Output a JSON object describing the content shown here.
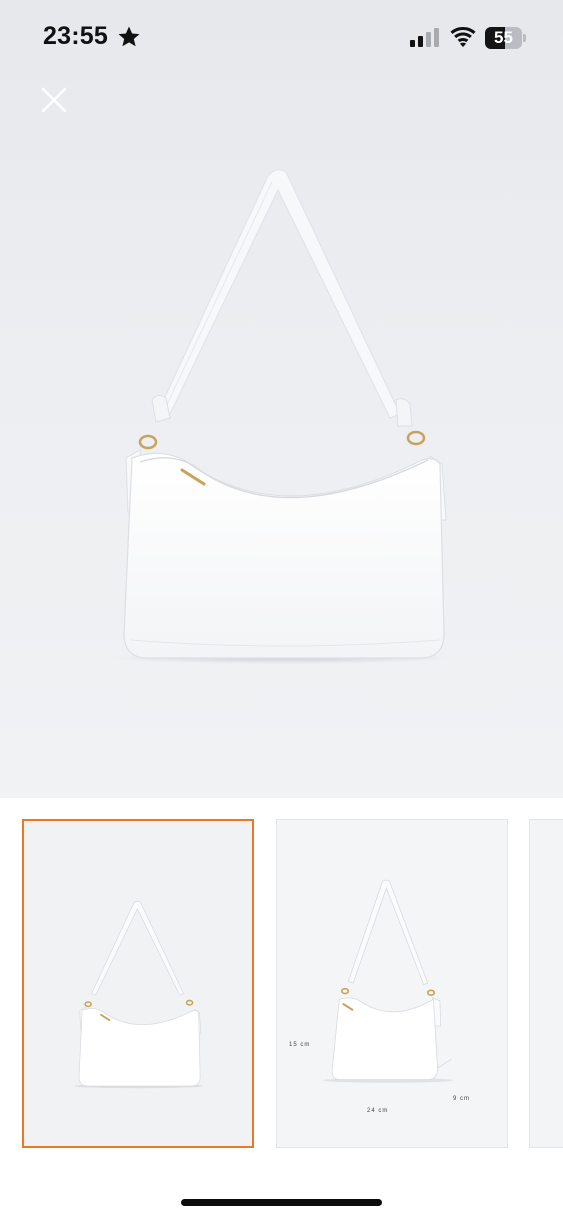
{
  "status_bar": {
    "time": "23:55",
    "battery_level": "55",
    "battery_fraction": 0.55,
    "icons": [
      "star-icon",
      "signal-icon",
      "wifi-icon",
      "battery-icon"
    ]
  },
  "viewer": {
    "close_icon": "close-icon",
    "main_image": "white-shoulder-bag-front"
  },
  "thumbnails": {
    "selected_index": 0,
    "selected_color": "#e8782a",
    "items": [
      {
        "name": "white-shoulder-bag-front"
      },
      {
        "name": "white-shoulder-bag-dimensions",
        "height_label": "15 cm",
        "width_label": "24 cm",
        "depth_label": "9 cm"
      },
      {
        "name": "white-shoulder-bag-partial"
      }
    ]
  }
}
